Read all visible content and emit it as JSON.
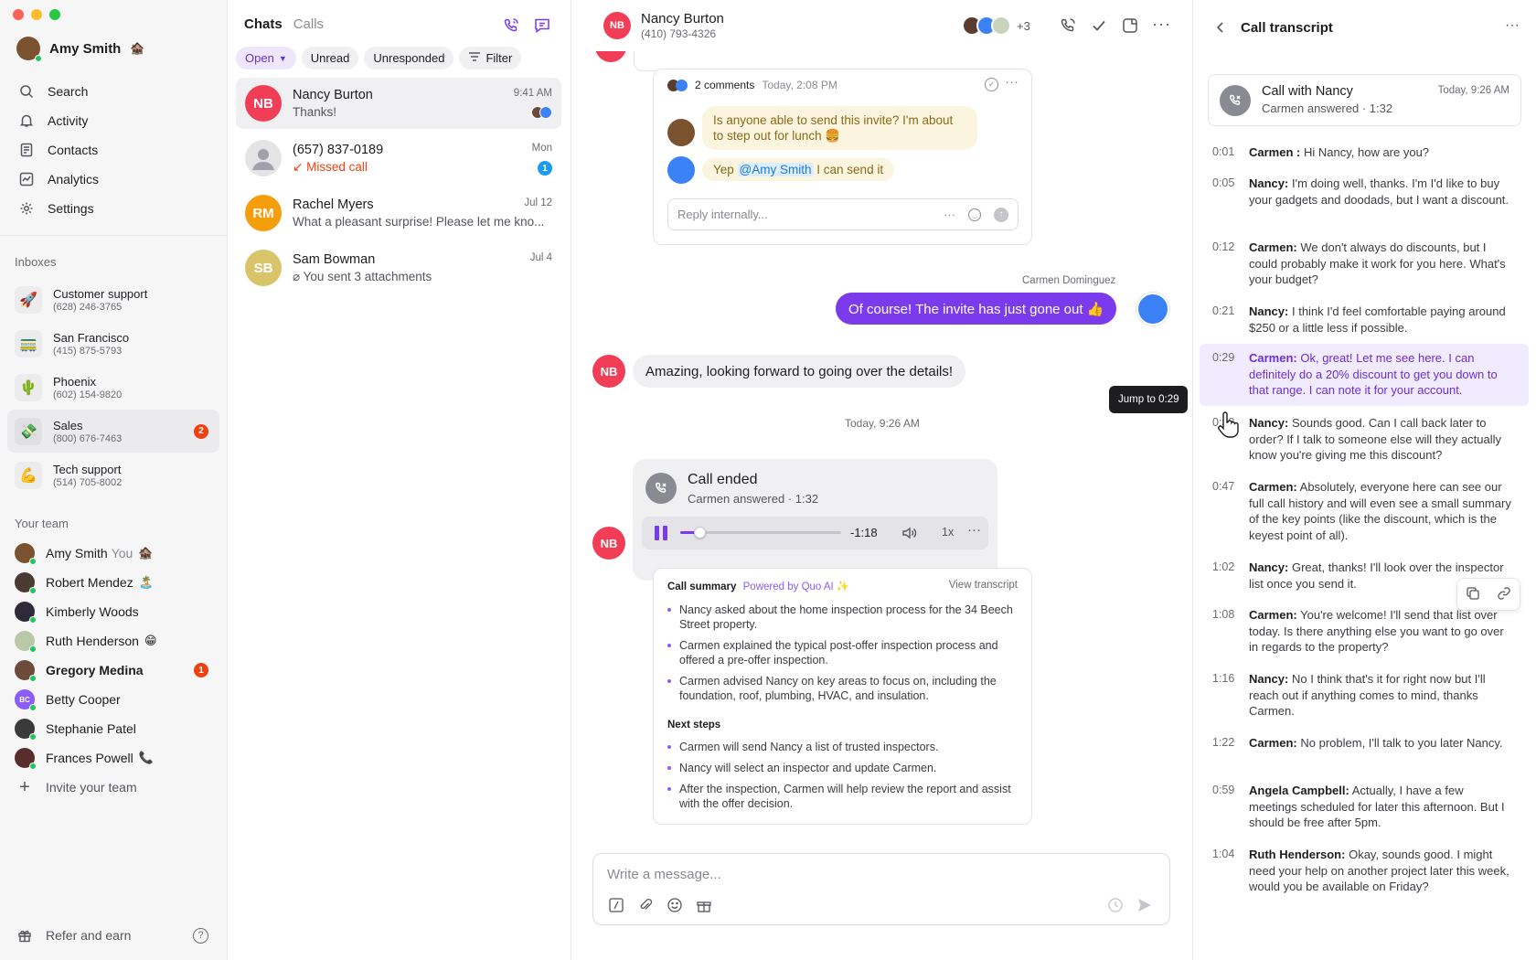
{
  "sidebar": {
    "user": {
      "name": "Amy Smith",
      "emoji": "🏚️"
    },
    "nav": [
      "Search",
      "Activity",
      "Contacts",
      "Analytics",
      "Settings"
    ],
    "inboxes_title": "Inboxes",
    "inboxes": [
      {
        "name": "Customer support",
        "phone": "(628) 246-3765",
        "emoji": "🚀"
      },
      {
        "name": "San Francisco",
        "phone": "(415) 875-5793",
        "emoji": "🚃"
      },
      {
        "name": "Phoenix",
        "phone": "(602) 154-9820",
        "emoji": "🌵"
      },
      {
        "name": "Sales",
        "phone": "(800) 676-7463",
        "emoji": "💸",
        "badge": "2"
      },
      {
        "name": "Tech support",
        "phone": "(514) 705-8002",
        "emoji": "💪"
      }
    ],
    "team_title": "Your team",
    "team": [
      {
        "name": "Amy Smith",
        "suffix": "You",
        "emoji": "🏚️",
        "color": "#7a5230"
      },
      {
        "name": "Robert Mendez",
        "emoji": "🏝️",
        "color": "#4b3a34"
      },
      {
        "name": "Kimberly Woods",
        "emoji": "",
        "color": "#2f2a3a"
      },
      {
        "name": "Ruth Henderson",
        "emoji": "😁",
        "color": "#b9c9a8"
      },
      {
        "name": "Gregory Medina",
        "emoji": "",
        "color": "#6d4a3a",
        "badge": "1",
        "bold": true
      },
      {
        "name": "Betty Cooper",
        "emoji": "",
        "initials": "BC",
        "color": "#8b5cf6"
      },
      {
        "name": "Stephanie Patel",
        "emoji": "",
        "color": "#3a3a3a"
      },
      {
        "name": "Frances Powell",
        "emoji": "📞",
        "color": "#5a2d2d"
      }
    ],
    "invite": "Invite your team",
    "refer": "Refer and earn"
  },
  "chatlist": {
    "tabs": [
      "Chats",
      "Calls"
    ],
    "filters": {
      "open": "Open",
      "unread": "Unread",
      "unresponded": "Unresponded",
      "filter": "Filter"
    },
    "items": [
      {
        "initials": "NB",
        "name": "Nancy Burton",
        "preview": "Thanks!",
        "time": "9:41 AM",
        "color": "#f23d56"
      },
      {
        "initials": "",
        "name": "(657) 837-0189",
        "preview": "Missed call",
        "time": "Mon",
        "color": "#d4d4d8",
        "badge": "1"
      },
      {
        "initials": "RM",
        "name": "Rachel Myers",
        "preview": "What a pleasant surprise! Please let me kno...",
        "time": "Jul 12",
        "color": "#f59e0b"
      },
      {
        "initials": "SB",
        "name": "Sam Bowman",
        "preview": "You sent 3 attachments",
        "time": "Jul 4",
        "color": "#d9c46a"
      }
    ]
  },
  "convo": {
    "contact": {
      "initials": "NB",
      "name": "Nancy Burton",
      "phone": "(410) 793-4326"
    },
    "participants_more": "+3",
    "thread": {
      "count": "2 comments",
      "time": "Today, 2:08 PM",
      "msg1": "Is anyone able to send this invite? I'm about to step out for lunch 🍔",
      "msg2_pre": "Yep",
      "msg2_mention": "@Amy Smith",
      "msg2_post": "I can send it",
      "reply_placeholder": "Reply internally..."
    },
    "sender_name": "Carmen Dominguez",
    "outgoing": "Of course! The invite has just gone out 👍",
    "incoming": "Amazing, looking forward to going over the details!",
    "tooltip": "Jump to 0:29",
    "date_sep": "Today, 9:26 AM",
    "call": {
      "title": "Call ended",
      "sub": "Carmen answered · 1:32",
      "remaining": "-1:18",
      "speed": "1x",
      "progress": 0.12
    },
    "summary": {
      "title": "Call summary",
      "powered": "Powered by Quo AI ✨",
      "view": "View transcript",
      "points": [
        "Nancy asked about the home inspection process for the 34 Beech Street property.",
        "Carmen explained the typical post-offer inspection process and offered a pre-offer inspection.",
        "Carmen advised Nancy on key areas to focus on, including the foundation, roof, plumbing, HVAC, and insulation."
      ],
      "next_title": "Next steps",
      "next": [
        "Carmen will send Nancy a list of trusted inspectors.",
        "Nancy will select an inspector and update Carmen.",
        "After the inspection, Carmen will help review the report and assist with the offer decision."
      ]
    },
    "composer_placeholder": "Write a message..."
  },
  "transcript": {
    "title": "Call transcript",
    "call_title": "Call with Nancy",
    "call_sub": "Carmen answered · 1:32",
    "call_time": "Today, 9:26 AM",
    "lines": [
      {
        "t": "0:01",
        "who": "Carmen :",
        "text": "Hi Nancy, how are you?"
      },
      {
        "t": "0:05",
        "who": "Nancy:",
        "text": "I'm doing well, thanks. I'm I'd like to buy your gadgets and doodads, but I want a discount."
      },
      {
        "t": "0:12",
        "who": "Carmen:",
        "text": "We don't always do discounts, but I could probably make it work for you here. What's your budget?"
      },
      {
        "t": "0:21",
        "who": "Nancy:",
        "text": "I think I'd feel comfortable paying around $250 or a little less if possible."
      },
      {
        "t": "0:29",
        "who": "Carmen:",
        "text": "Ok, great! Let me see here. I can definitely do a 20% discount to get you down to that range. I can note it for your account."
      },
      {
        "t": "0:38",
        "who": "Nancy:",
        "text": "Sounds good. Can I call back later to order? If I talk to someone else will they actually know you're giving me this discount?"
      },
      {
        "t": "0:47",
        "who": "Carmen:",
        "text": "Absolutely, everyone here can see our full call history and will even see a small summary of the key points (like the discount, which is the keyest point of all)."
      },
      {
        "t": "1:02",
        "who": "Nancy:",
        "text": "Great, thanks! I'll look over the inspector list once you send it."
      },
      {
        "t": "1:08",
        "who": "Carmen:",
        "text": "You're welcome! I'll send that list over today. Is there anything else you want to go over in regards to the property?"
      },
      {
        "t": "1:16",
        "who": "Nancy:",
        "text": "No I think that's it for right now but I'll reach out if anything comes to mind, thanks Carmen."
      },
      {
        "t": "1:22",
        "who": "Carmen:",
        "text": "No problem, I'll talk to you later Nancy."
      },
      {
        "t": "0:59",
        "who": "Angela Campbell:",
        "text": "Actually, I have a few meetings scheduled for later this afternoon. But I should be free after 5pm."
      },
      {
        "t": "1:04",
        "who": "Ruth Henderson:",
        "text": "Okay, sounds good. I might need your help on another project later this week, would you be available on Friday?"
      }
    ]
  },
  "colors": {
    "accent": "#7c3aed",
    "bubble_out": "#7c3aed",
    "danger": "#f0400f",
    "nb": "#f23d56"
  }
}
